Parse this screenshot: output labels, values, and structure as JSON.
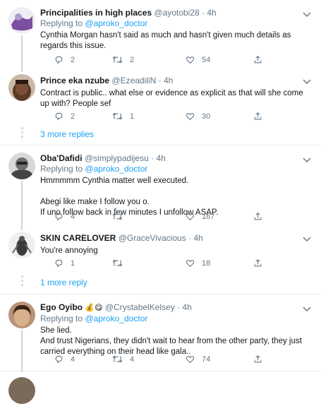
{
  "tweets": [
    {
      "name": "Principalities in high places",
      "handle": "@ayotobi28",
      "time": "4h",
      "reply_prefix": "Replying to",
      "reply_to": "@aproko_doctor",
      "text": "Cynthia Morgan hasn't said as much and hasn't given much details as regards this issue.",
      "replies": "2",
      "retweets": "2",
      "likes": "54"
    },
    {
      "name": "Prince eka nzube",
      "handle": "@EzeadiliN",
      "time": "4h",
      "text": "Contract is public.. what else or evidence as explicit as that will she come up with? People sef",
      "replies": "2",
      "retweets": "1",
      "likes": "30"
    },
    {
      "name": "Oba'Dafidi",
      "handle": "@simplypadijesu",
      "time": "4h",
      "reply_prefix": "Replying to",
      "reply_to": "@aproko_doctor",
      "text": "Hmmmmm Cynthia matter well executed.\n\nAbegi like make I follow you o.\nIf uno follow back in few minutes I unfollow ASAP.",
      "replies": "4",
      "retweets": "",
      "likes": "167"
    },
    {
      "name": "SKIN CARELOVER",
      "handle": "@GraceVivacious",
      "time": "4h",
      "text": "You're annoying",
      "replies": "1",
      "retweets": "",
      "likes": "18"
    },
    {
      "name": "Ego Oyibo",
      "name_emoji": "💰😋",
      "handle": "@CrystabelKelsey",
      "time": "4h",
      "reply_prefix": "Replying to",
      "reply_to": "@aproko_doctor",
      "text": "She lied.\nAnd trust Nigerians, they didn't wait to hear from the other party, they just carried everything on their head like gala..",
      "replies": "4",
      "retweets": "4",
      "likes": "74"
    }
  ],
  "more_replies": [
    "3 more replies",
    "1 more reply"
  ],
  "separator": "·",
  "colors": {
    "link": "#1da1f2",
    "muted": "#657786",
    "border": "#e6ecf0"
  }
}
